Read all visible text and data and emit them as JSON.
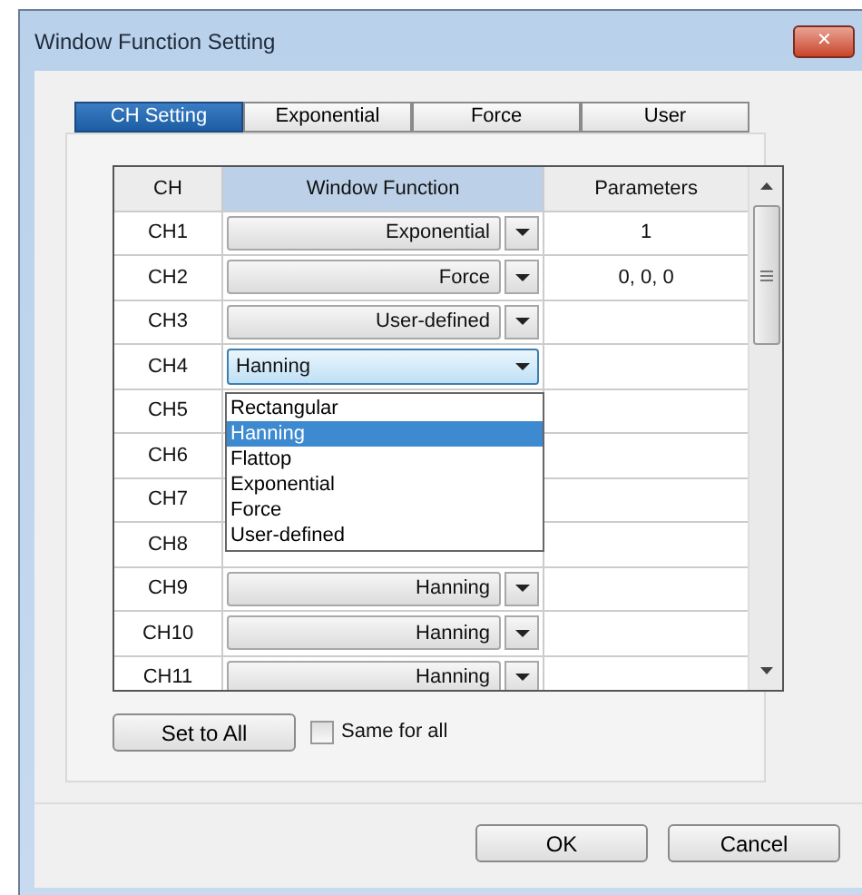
{
  "window": {
    "title": "Window Function Setting",
    "close_label": "✕"
  },
  "tabs": [
    {
      "label": "CH Setting",
      "selected": true
    },
    {
      "label": "Exponential",
      "selected": false
    },
    {
      "label": "Force",
      "selected": false
    },
    {
      "label": "User",
      "selected": false
    }
  ],
  "table": {
    "columns": [
      "CH",
      "Window Function",
      "Parameters"
    ],
    "rows": [
      {
        "ch": "CH1",
        "function": "Exponential",
        "parameters": "1"
      },
      {
        "ch": "CH2",
        "function": "Force",
        "parameters": "0, 0, 0"
      },
      {
        "ch": "CH3",
        "function": "User-defined"
      },
      {
        "ch": "CH4",
        "function": "Hanning",
        "editing": true
      },
      {
        "ch": "CH5"
      },
      {
        "ch": "CH6"
      },
      {
        "ch": "CH7"
      },
      {
        "ch": "CH8"
      },
      {
        "ch": "CH9",
        "function": "Hanning"
      },
      {
        "ch": "CH10",
        "function": "Hanning"
      },
      {
        "ch": "CH11",
        "function": "Hanning"
      }
    ],
    "dropdown": {
      "options": [
        {
          "label": "Rectangular",
          "selected": false
        },
        {
          "label": "Hanning",
          "selected": true
        },
        {
          "label": "Flattop",
          "selected": false
        },
        {
          "label": "Exponential",
          "selected": false
        },
        {
          "label": "Force",
          "selected": false
        },
        {
          "label": "User-defined",
          "selected": false
        }
      ]
    }
  },
  "set_to_all_button": "Set to All",
  "same_for_all": {
    "label": "Same for all",
    "checked": false
  },
  "buttons": [
    "OK",
    "Cancel"
  ]
}
